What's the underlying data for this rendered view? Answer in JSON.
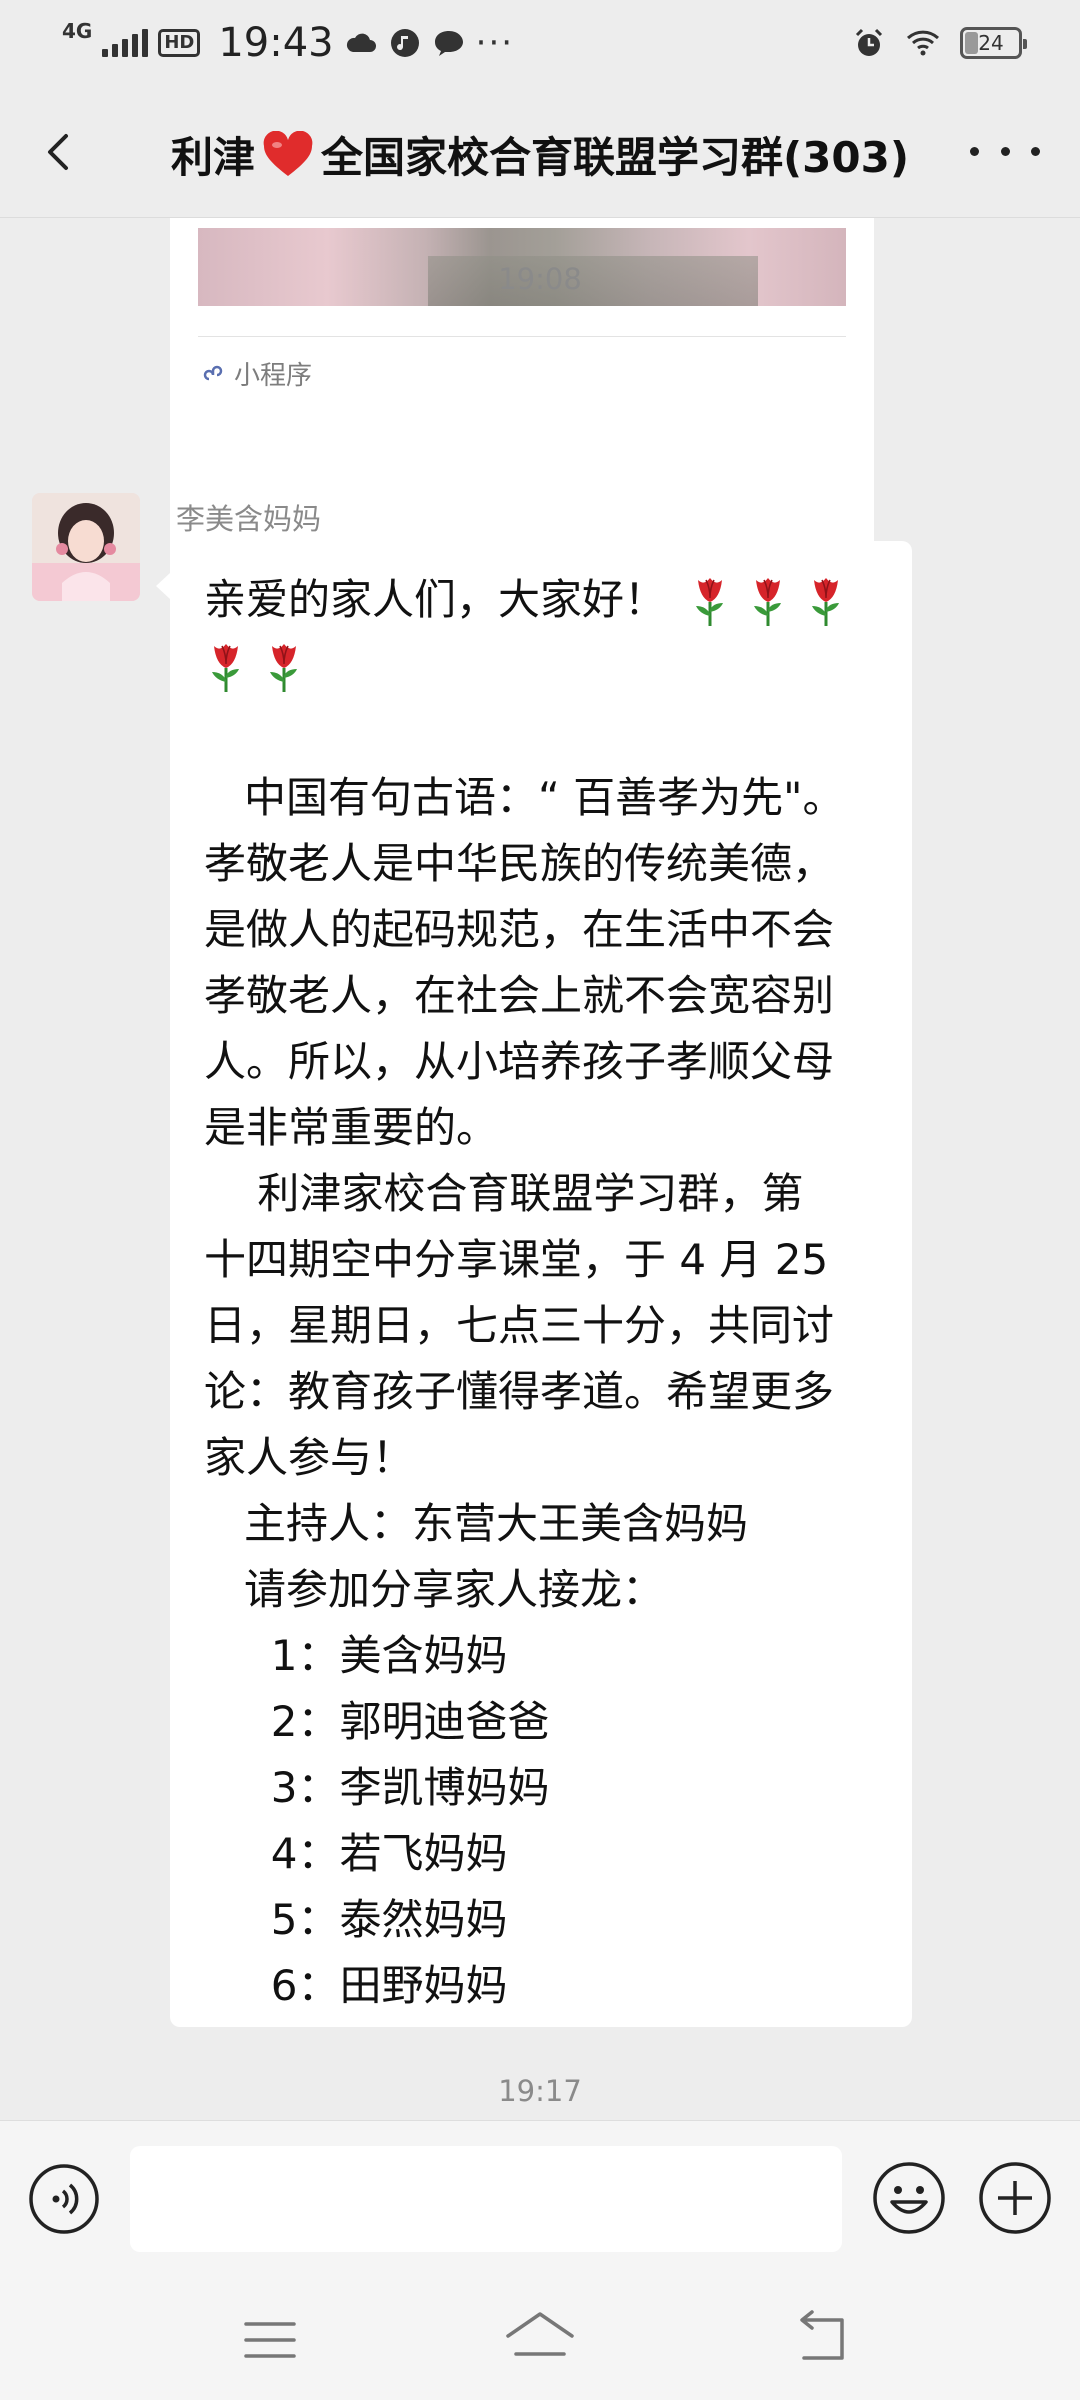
{
  "status_bar": {
    "network": "4G",
    "hd_label": "HD",
    "time": "19:43",
    "more": "···",
    "battery_level": "24"
  },
  "header": {
    "title_prefix": "利津",
    "title_suffix": "全国家校合育联盟学习群(303)"
  },
  "mini_program": {
    "label": "小程序"
  },
  "timestamps": {
    "first": "19:08",
    "second": "19:17"
  },
  "message": {
    "sender": "李美含妈妈",
    "greeting": "亲爱的家人们，大家好！",
    "roses_line1": 3,
    "roses_line2": 2,
    "lines": [
      "   中国有句古语：“ 百善孝为先\"。",
      "孝敬老人是中华民族的传统美德，",
      "是做人的起码规范，在生活中不会",
      "孝敬老人，在社会上就不会宽容别",
      "人。所以，从小培养孩子孝顺父母",
      "是非常重要的。",
      "    利津家校合育联盟学习群，第",
      "十四期空中分享课堂，于 4 月 25",
      "日，星期日，七点三十分，共同讨",
      "论：教育孩子懂得孝道。希望更多",
      "家人参与！",
      "   主持人：东营大王美含妈妈",
      "   请参加分享家人接龙：",
      "     1：美含妈妈",
      "     2：郭明迪爸爸",
      "     3：李凯博妈妈",
      "     4：若飞妈妈",
      "     5：泰然妈妈",
      "     6：田野妈妈"
    ]
  },
  "input": {
    "value": ""
  },
  "colors": {
    "background": "#ededed",
    "bubble": "#ffffff",
    "heart": "#e02c2c",
    "rose": "#d6242a"
  }
}
